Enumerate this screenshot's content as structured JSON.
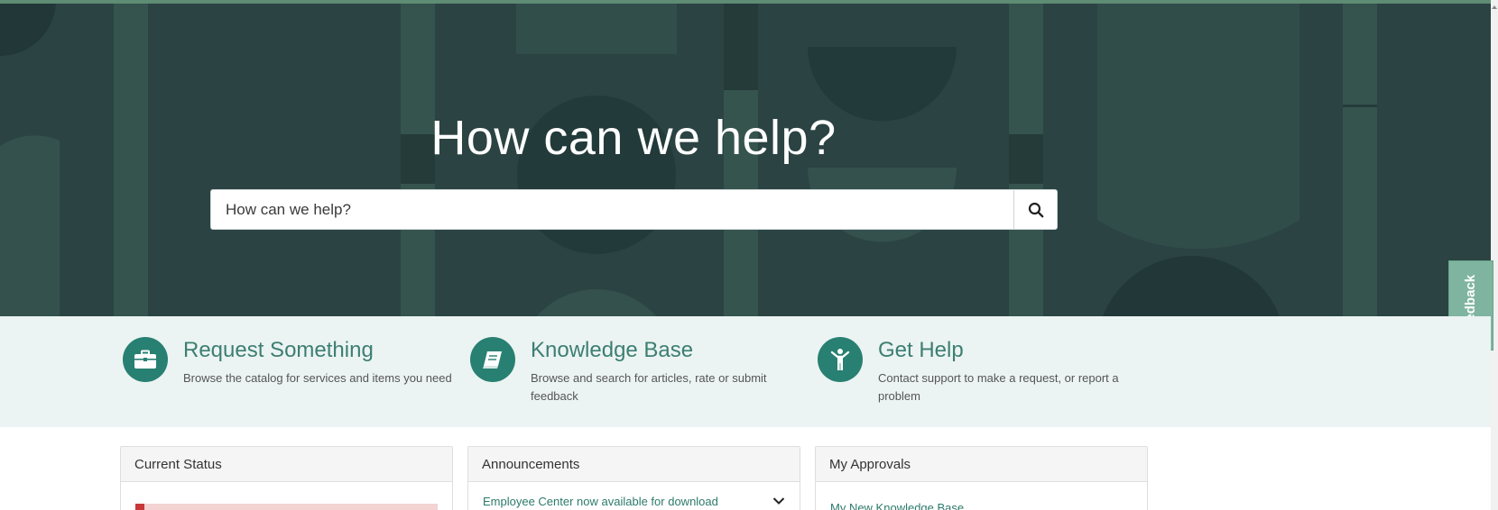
{
  "hero": {
    "title": "How can we help?",
    "search_placeholder": "How can we help?"
  },
  "feedback": {
    "label": "Feedback"
  },
  "quick_links": [
    {
      "title": "Request Something",
      "description": "Browse the catalog for services and items you need",
      "icon": "briefcase-icon"
    },
    {
      "title": "Knowledge Base",
      "description": "Browse and search for articles, rate or submit feedback",
      "icon": "book-icon"
    },
    {
      "title": "Get Help",
      "description": "Contact support to make a request, or report a problem",
      "icon": "person-icon"
    }
  ],
  "cards": {
    "current_status": {
      "title": "Current Status"
    },
    "announcements": {
      "title": "Announcements",
      "items": [
        "Employee Center now available for download"
      ]
    },
    "approvals": {
      "title": "My Approvals",
      "items": [
        "My New Knowledge Base"
      ]
    }
  },
  "colors": {
    "hero_bg": "#2b4343",
    "accent": "#288072",
    "link": "#2d7a6b",
    "quick_bg": "#ebf4f2",
    "feedback_bg": "#7fb5a0"
  }
}
